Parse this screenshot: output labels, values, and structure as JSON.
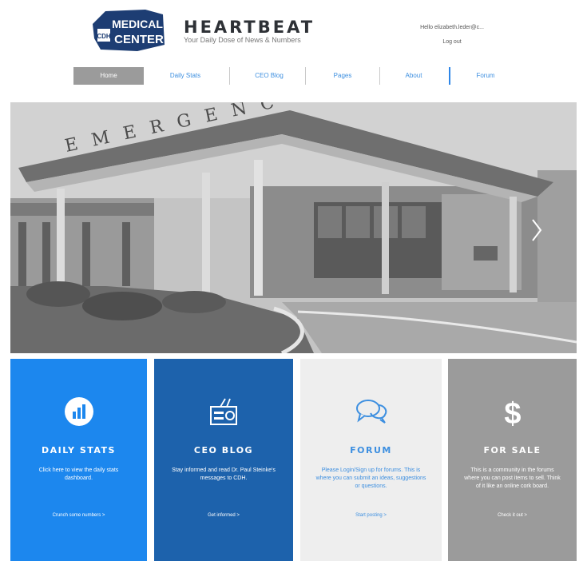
{
  "header": {
    "logo_line1": "MEDICAL",
    "logo_line2": "CENTER",
    "logo_badge": "CDH",
    "title": "HEARTBEAT",
    "tagline": "Your Daily Dose of News & Numbers",
    "user_greeting": "Hello elizabeth.leder@c...",
    "logout": "Log out"
  },
  "nav": {
    "items": [
      {
        "label": "Home"
      },
      {
        "label": "Daily Stats"
      },
      {
        "label": "CEO Blog"
      },
      {
        "label": "Pages"
      },
      {
        "label": "About"
      },
      {
        "label": "Forum"
      }
    ]
  },
  "hero": {
    "sign_text": "EMERGENC",
    "next_icon": "chevron-right-icon"
  },
  "tiles": [
    {
      "title": "DAILY STATS",
      "desc": "Click here to view the daily stats dashboard.",
      "link": "Crunch some numbers >",
      "icon": "bar-chart-icon",
      "color": "#1c87ee"
    },
    {
      "title": "CEO BLOG",
      "desc": "Stay informed and read Dr. Paul Steinke's messages to CDH.",
      "link": "Get informed >",
      "icon": "radio-icon",
      "color": "#1d62ac"
    },
    {
      "title": "FORUM",
      "desc": "Please Login/Sign up for forums. This is where you can submit an ideas, suggestions or questions.",
      "link": "Start posting >",
      "icon": "chat-bubbles-icon",
      "color": "#eeeeee"
    },
    {
      "title": "FOR SALE",
      "desc": "This is a community in the forums where you can post items to sell. Think of it like an online cork board.",
      "link": "Check it out >",
      "icon": "dollar-icon",
      "color": "#9b9b9b"
    }
  ]
}
